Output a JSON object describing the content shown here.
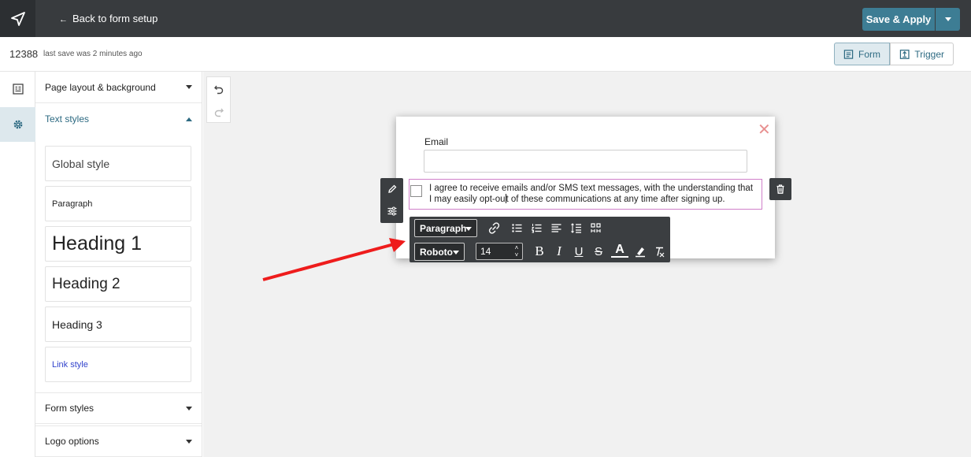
{
  "header": {
    "back_label": "Back to form setup",
    "back_arrow": "←",
    "save_label": "Save & Apply"
  },
  "subbar": {
    "form_id": "12388",
    "save_status": "last save was 2 minutes ago",
    "tab_form": "Form",
    "tab_trigger": "Trigger"
  },
  "panel": {
    "sections": {
      "page_layout": "Page layout & background",
      "text_styles": "Text styles",
      "form_styles": "Form styles",
      "logo_options": "Logo options"
    },
    "styles": {
      "global": "Global style",
      "paragraph": "Paragraph",
      "h1": "Heading 1",
      "h2": "Heading 2",
      "h3": "Heading 3",
      "link": "Link style"
    }
  },
  "popup": {
    "email_label": "Email",
    "consent_text_before": "I agree to receive emails and/or SMS text messages, with the understanding that I may easily opt-ou",
    "consent_text_after": "t of these communications at any time after signing up.",
    "close_symbol": "✕"
  },
  "toolbar": {
    "block_type": "Paragraph",
    "font": "Roboto",
    "font_size": "14"
  },
  "colors": {
    "topbar": "#383b3e",
    "accent": "#3d7d94",
    "selection_border": "#d07fc9",
    "annotation_arrow": "#ee1c1c",
    "link": "#3344cc"
  }
}
